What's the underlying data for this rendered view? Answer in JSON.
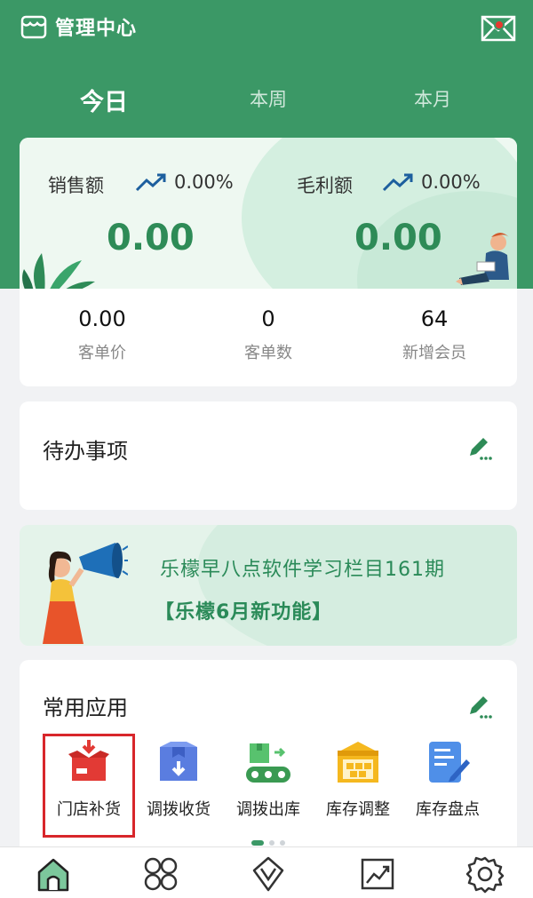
{
  "header": {
    "title": "管理中心",
    "tabs": [
      "今日",
      "本周",
      "本月"
    ],
    "active_tab": 0
  },
  "sales": {
    "revenue_label": "销售额",
    "revenue_change": "0.00%",
    "revenue_value": "0.00",
    "profit_label": "毛利额",
    "profit_change": "0.00%",
    "profit_value": "0.00",
    "stats": [
      {
        "value": "0.00",
        "label": "客单价"
      },
      {
        "value": "0",
        "label": "客单数"
      },
      {
        "value": "64",
        "label": "新增会员"
      }
    ]
  },
  "todo": {
    "title": "待办事项"
  },
  "banner": {
    "line1": "乐檬早八点软件学习栏目161期",
    "line2": "【乐檬6月新功能】"
  },
  "apps": {
    "title": "常用应用",
    "items": [
      {
        "label": "门店补货",
        "icon": "box-download-icon"
      },
      {
        "label": "调拨收货",
        "icon": "box-receive-icon"
      },
      {
        "label": "调拨出库",
        "icon": "conveyor-out-icon"
      },
      {
        "label": "库存调整",
        "icon": "warehouse-adjust-icon"
      },
      {
        "label": "库存盘点",
        "icon": "inventory-check-icon"
      }
    ],
    "highlighted_index": 0
  },
  "tabbar": {
    "items": [
      "home-icon",
      "apps-grid-icon",
      "diamond-icon",
      "chart-icon",
      "settings-icon"
    ],
    "active": 0
  },
  "colors": {
    "brand_green": "#3b9866",
    "value_green": "#2e8b57",
    "highlight_red": "#d8262b",
    "trend_blue": "#1d5f9e"
  }
}
